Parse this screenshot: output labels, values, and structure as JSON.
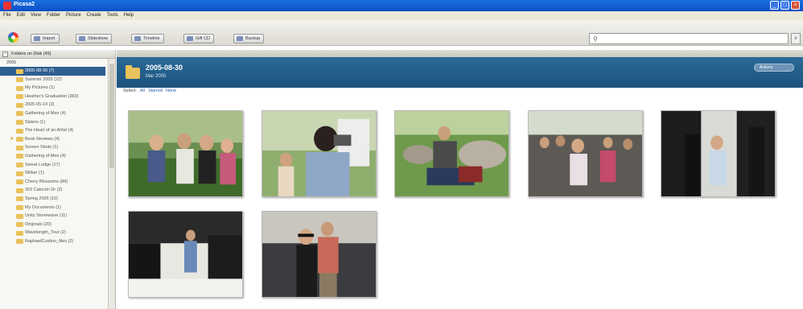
{
  "window": {
    "title": "Picasa2"
  },
  "menu": [
    "File",
    "Edit",
    "View",
    "Folder",
    "Picture",
    "Create",
    "Tools",
    "Help"
  ],
  "toolbar": {
    "buttons": [
      {
        "label": "Import",
        "icon": "import-icon"
      },
      {
        "label": "Slideshow",
        "icon": "slideshow-icon"
      },
      {
        "label": "Timeline",
        "icon": "timeline-icon"
      },
      {
        "label": "Gift CD",
        "icon": "gift-cd-icon"
      },
      {
        "label": "Backup",
        "icon": "backup-icon"
      }
    ],
    "search": {
      "value": "",
      "placeholder": ""
    }
  },
  "sidebar": {
    "header": "Folders on Disk (49)",
    "year": "2005",
    "items": [
      {
        "label": "2005-08-30 (7)",
        "selected": true
      },
      {
        "label": "Summer 2005 (22)"
      },
      {
        "label": "My Pictures (1)"
      },
      {
        "label": "Heather's Graduation (383)"
      },
      {
        "label": "2005-05-19 (3)"
      },
      {
        "label": "Gathering of Men (4)"
      },
      {
        "label": "Sisters (1)"
      },
      {
        "label": "The Heart of an Artist (4)"
      },
      {
        "label": "Book Reviews (4)",
        "starred": true
      },
      {
        "label": "Screen Shots (1)"
      },
      {
        "label": "Gathering of Men (4)"
      },
      {
        "label": "Sweat Lodge (17)"
      },
      {
        "label": "Wilber (1)"
      },
      {
        "label": "Cherry Blossoms (84)"
      },
      {
        "label": "303 Catoctin Dr (2)"
      },
      {
        "label": "Spring 2005 (10)"
      },
      {
        "label": "My Documents (1)"
      },
      {
        "label": "Unity Stonewave (11)"
      },
      {
        "label": "Originals (20)"
      },
      {
        "label": "Wavelength_Tour (2)"
      },
      {
        "label": "RaphaelCustino_files (2)"
      }
    ]
  },
  "main": {
    "folder_title": "2005-08-30",
    "folder_date": "Mar 2005",
    "folder_button": "Actions",
    "select_label": "Select:",
    "select_all": "All",
    "select_starred": "Starred",
    "select_none": "None"
  },
  "photos": [
    {
      "name": "photo-group-women",
      "scene": "group"
    },
    {
      "name": "photo-woman-camcorder",
      "scene": "camcorder"
    },
    {
      "name": "photo-man-seated-rocks",
      "scene": "seated"
    },
    {
      "name": "photo-crowd-outdoors",
      "scene": "crowd"
    },
    {
      "name": "photo-graduates-gowns",
      "scene": "gowns"
    },
    {
      "name": "photo-graduation-line",
      "scene": "line"
    },
    {
      "name": "photo-graduate-with-father",
      "scene": "pair"
    }
  ]
}
